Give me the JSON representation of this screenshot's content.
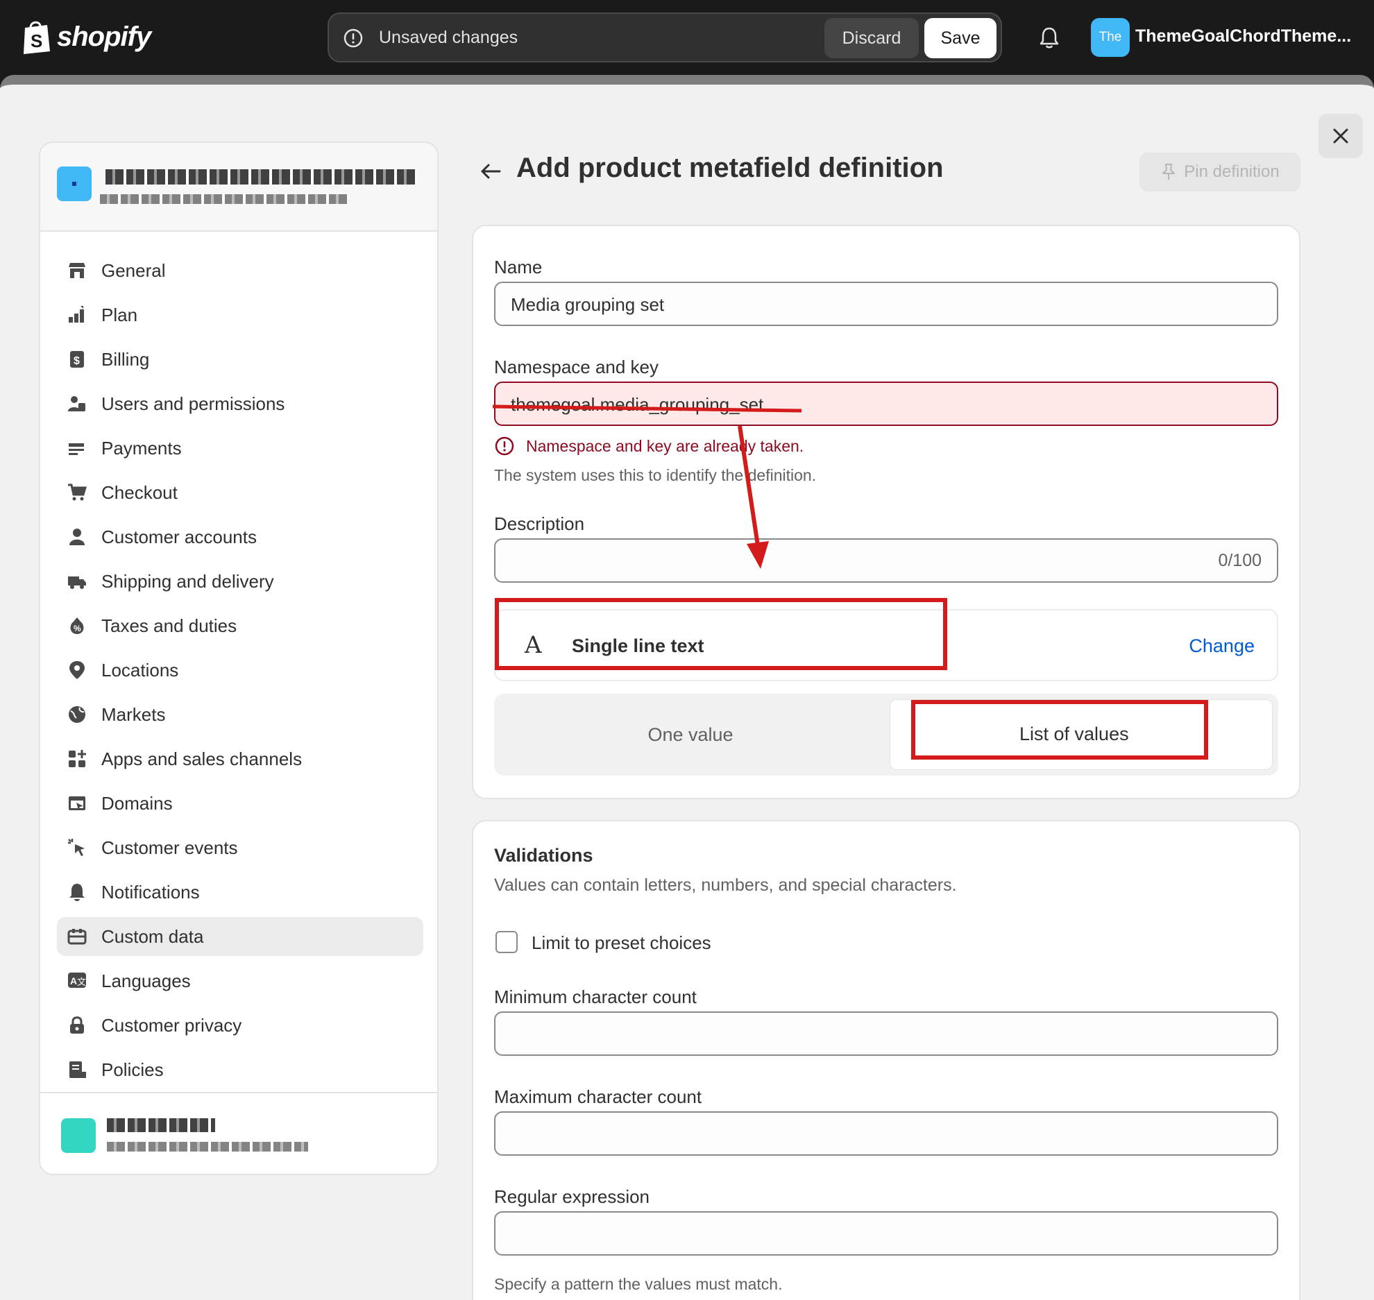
{
  "topbar": {
    "logo_text": "shopify",
    "unsaved_text": "Unsaved changes",
    "discard_label": "Discard",
    "save_label": "Save",
    "store_avatar_text": "The",
    "store_name": "ThemeGoalChordTheme..."
  },
  "sidebar": {
    "items": [
      {
        "label": "General",
        "icon": "store-icon"
      },
      {
        "label": "Plan",
        "icon": "plan-icon"
      },
      {
        "label": "Billing",
        "icon": "billing-icon"
      },
      {
        "label": "Users and permissions",
        "icon": "users-icon"
      },
      {
        "label": "Payments",
        "icon": "payments-icon"
      },
      {
        "label": "Checkout",
        "icon": "cart-icon"
      },
      {
        "label": "Customer accounts",
        "icon": "person-icon"
      },
      {
        "label": "Shipping and delivery",
        "icon": "truck-icon"
      },
      {
        "label": "Taxes and duties",
        "icon": "tax-icon"
      },
      {
        "label": "Locations",
        "icon": "location-icon"
      },
      {
        "label": "Markets",
        "icon": "globe-icon"
      },
      {
        "label": "Apps and sales channels",
        "icon": "apps-icon"
      },
      {
        "label": "Domains",
        "icon": "domains-icon"
      },
      {
        "label": "Customer events",
        "icon": "cursor-icon"
      },
      {
        "label": "Notifications",
        "icon": "bell-icon"
      },
      {
        "label": "Custom data",
        "icon": "custom-data-icon",
        "active": true
      },
      {
        "label": "Languages",
        "icon": "translate-icon"
      },
      {
        "label": "Customer privacy",
        "icon": "lock-icon"
      },
      {
        "label": "Policies",
        "icon": "policies-icon"
      }
    ]
  },
  "header": {
    "title": "Add product metafield definition",
    "pin_label": "Pin definition"
  },
  "form": {
    "name_label": "Name",
    "name_value": "Media grouping set",
    "namespace_label": "Namespace and key",
    "namespace_value": "themegoal.media_grouping_set",
    "namespace_error": "Namespace and key are already taken.",
    "namespace_help": "The system uses this to identify the definition.",
    "description_label": "Description",
    "description_value": "",
    "description_counter": "0/100",
    "type_glyph": "A",
    "type_name": "Single line text",
    "change_label": "Change",
    "one_value_label": "One value",
    "list_values_label": "List of values"
  },
  "validations": {
    "title": "Validations",
    "subtitle": "Values can contain letters, numbers, and special characters.",
    "preset_label": "Limit to preset choices",
    "preset_checked": false,
    "min_label": "Minimum character count",
    "max_label": "Maximum character count",
    "regex_label": "Regular expression",
    "regex_help": "Specify a pattern the values must match."
  },
  "colors": {
    "accent": "#005bd3",
    "critical": "#8e0b21",
    "annotation_red": "#d31b1b"
  }
}
